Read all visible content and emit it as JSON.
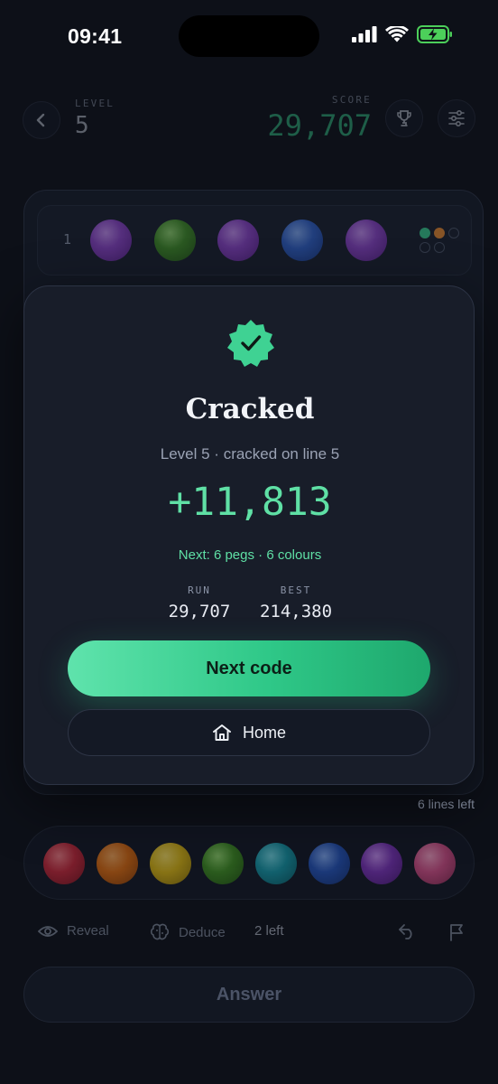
{
  "status": {
    "time": "09:41"
  },
  "header": {
    "level_label": "LEVEL",
    "level_value": "5",
    "score_label": "SCORE",
    "score_value": "29,707"
  },
  "board": {
    "row": {
      "number": "1",
      "pegs": [
        "purple",
        "green",
        "purple",
        "blue",
        "purple"
      ],
      "feedback": [
        "green",
        "orange",
        "empty",
        "empty",
        "empty"
      ]
    }
  },
  "tray": {
    "lines_left": "6 lines left",
    "colors": [
      "red",
      "orange",
      "yellow",
      "green",
      "teal",
      "blue",
      "purple",
      "pink"
    ]
  },
  "tools": {
    "reveal_label": "Reveal",
    "deduce_label": "Deduce",
    "hints_left": "2 left"
  },
  "answer_label": "Answer",
  "modal": {
    "title": "Cracked",
    "subtitle": "Level 5 · cracked on line 5",
    "points": "+11,813",
    "next_info": "Next: 6 pegs · 6 colours",
    "run_label": "RUN",
    "run_value": "29,707",
    "best_label": "BEST",
    "best_value": "214,380",
    "next_button": "Next code",
    "home_button": "Home"
  },
  "colors": {
    "accent": "#36c98a",
    "peg_red": "#c4283a",
    "peg_orange": "#d96a10",
    "peg_yellow": "#d9b514",
    "peg_green": "#3f8e22",
    "peg_teal": "#1596a6",
    "peg_blue": "#2453b8",
    "peg_purple": "#7a33b8",
    "peg_pink": "#d04e86"
  },
  "icons": [
    "back-icon",
    "trophy-icon",
    "settings-sliders-icon",
    "verified-badge-icon",
    "home-icon",
    "eye-icon",
    "brain-icon",
    "undo-icon",
    "flag-icon"
  ]
}
